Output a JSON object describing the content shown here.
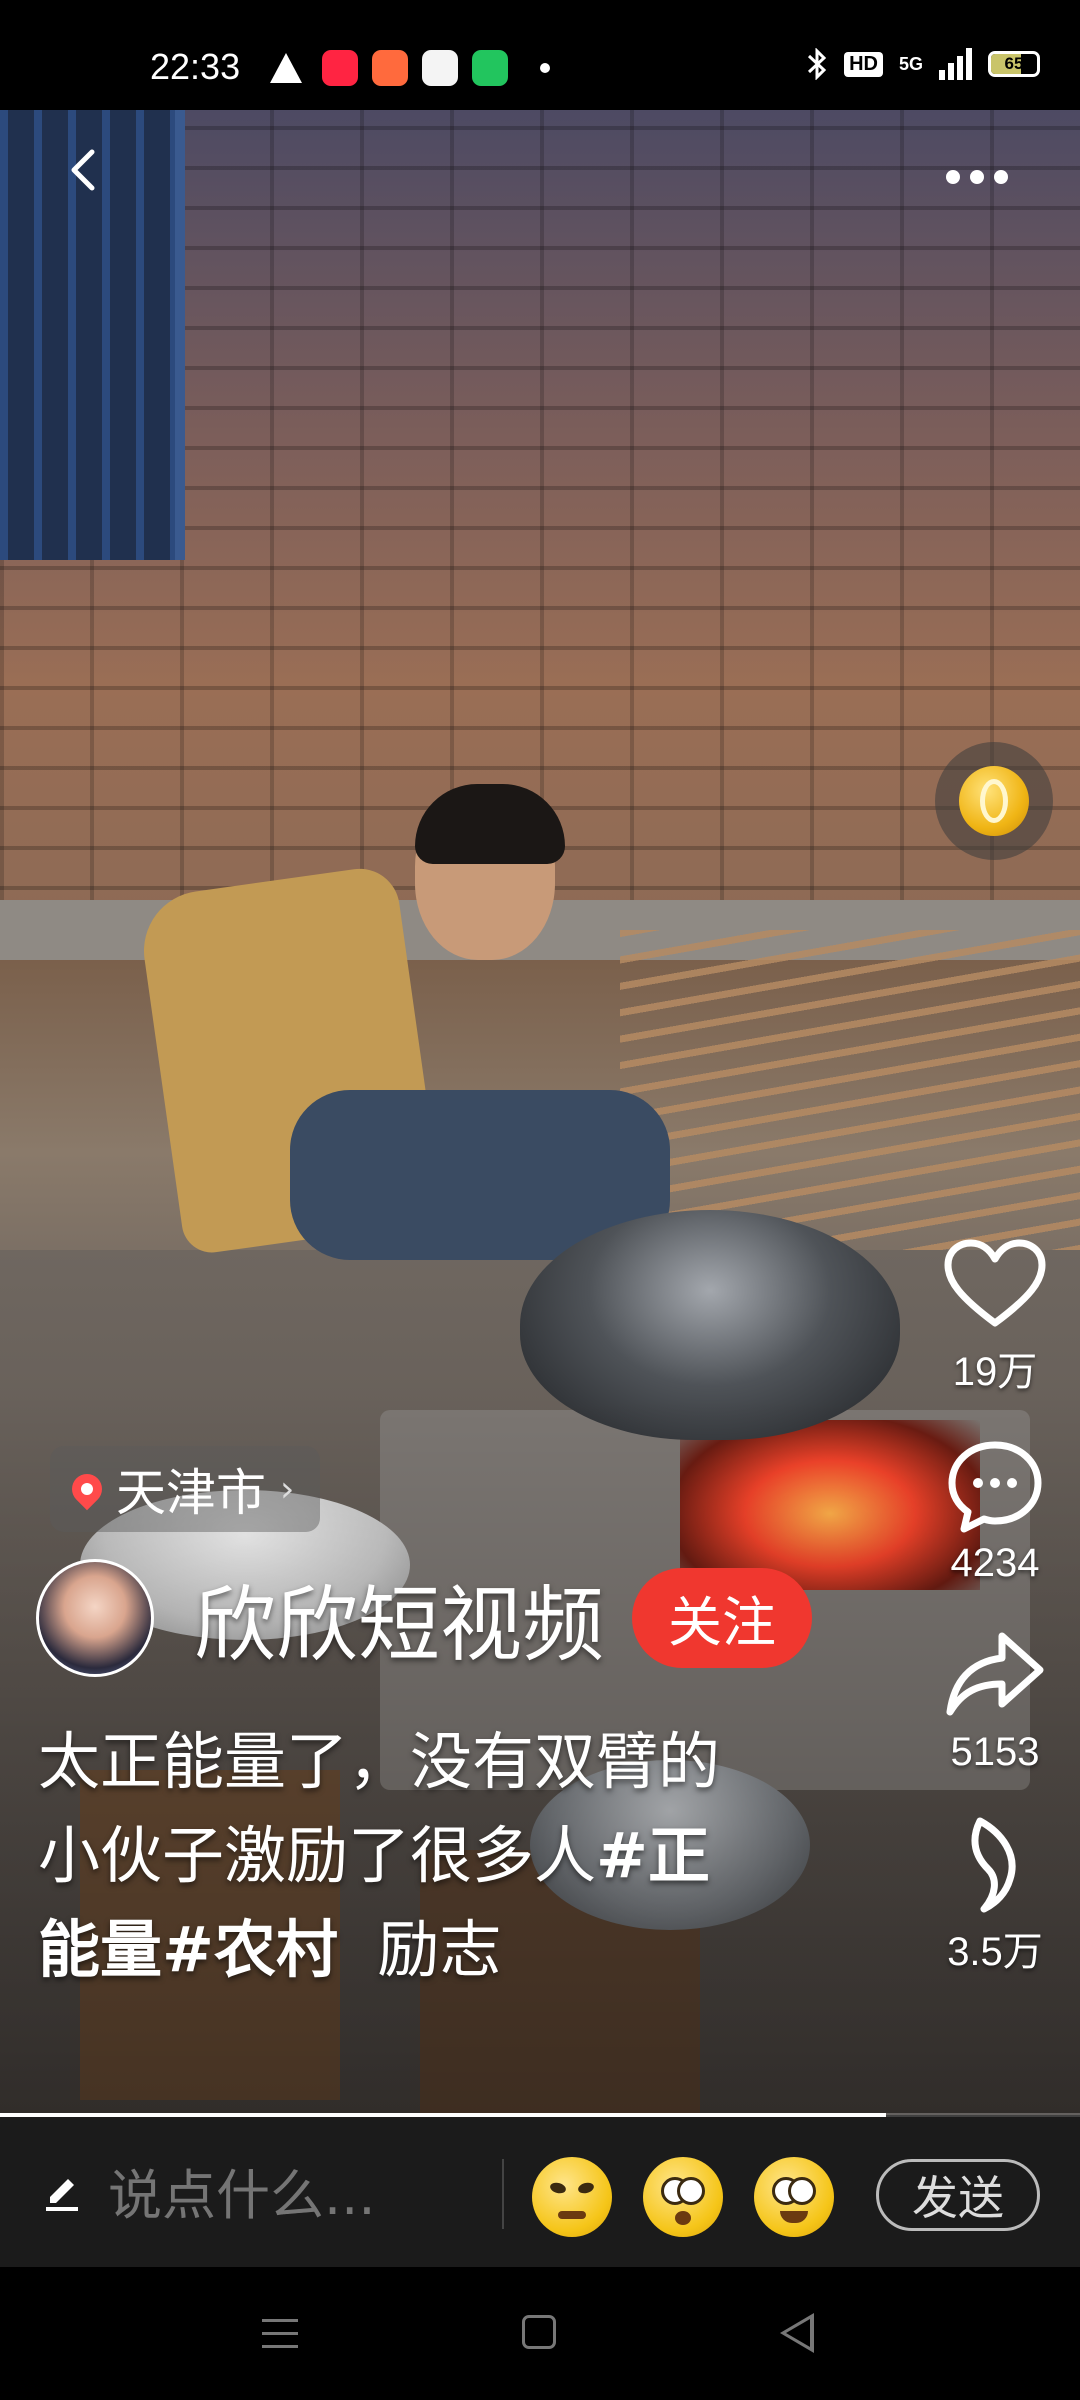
{
  "status_bar": {
    "time": "22:33",
    "network": "5G",
    "hd_label": "HD",
    "battery": "65",
    "icons": [
      "warning-icon",
      "xiaohongshu-app-icon",
      "app-icon",
      "game-app-icon",
      "shopping-app-icon",
      "dot-icon",
      "bluetooth-icon",
      "hd-icon",
      "signal-icon",
      "battery-icon"
    ]
  },
  "video": {
    "location": "天津市",
    "author": "欣欣短视频",
    "follow_label": "关注",
    "caption_line1": "太正能量了，没有双臂的",
    "caption_line2_plain": "小伙子激励了很多人",
    "caption_tag1": "#正",
    "caption_line3_tag": "能量#农村",
    "caption_line3_plain": "励志",
    "progress": 0.82
  },
  "actions": {
    "likes": "19万",
    "comments": "4234",
    "shares": "5153",
    "favorites": "3.5万"
  },
  "comment_bar": {
    "placeholder": "说点什么...",
    "send_label": "发送",
    "emojis": [
      "smirk-emoji",
      "crying-emoji",
      "happy-emoji"
    ]
  },
  "colors": {
    "follow_button": "#f0372f",
    "coin": "#f0b515",
    "location_pin": "#ff4a4a"
  }
}
